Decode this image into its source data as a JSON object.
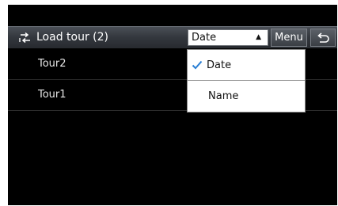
{
  "header": {
    "title": "Load tour (2)",
    "icon": "load-tour-icon"
  },
  "sort": {
    "selected": "Date",
    "arrow": "▲",
    "options": [
      {
        "label": "Date",
        "checked": true
      },
      {
        "label": "Name",
        "checked": false
      }
    ]
  },
  "buttons": {
    "menu_label": "Menu",
    "back_icon": "back-icon"
  },
  "tours": [
    {
      "label": "Tour2"
    },
    {
      "label": "Tour1"
    }
  ],
  "colors": {
    "screen": "#000000",
    "titlebar": "#33373d",
    "check": "#2a7fd4"
  }
}
